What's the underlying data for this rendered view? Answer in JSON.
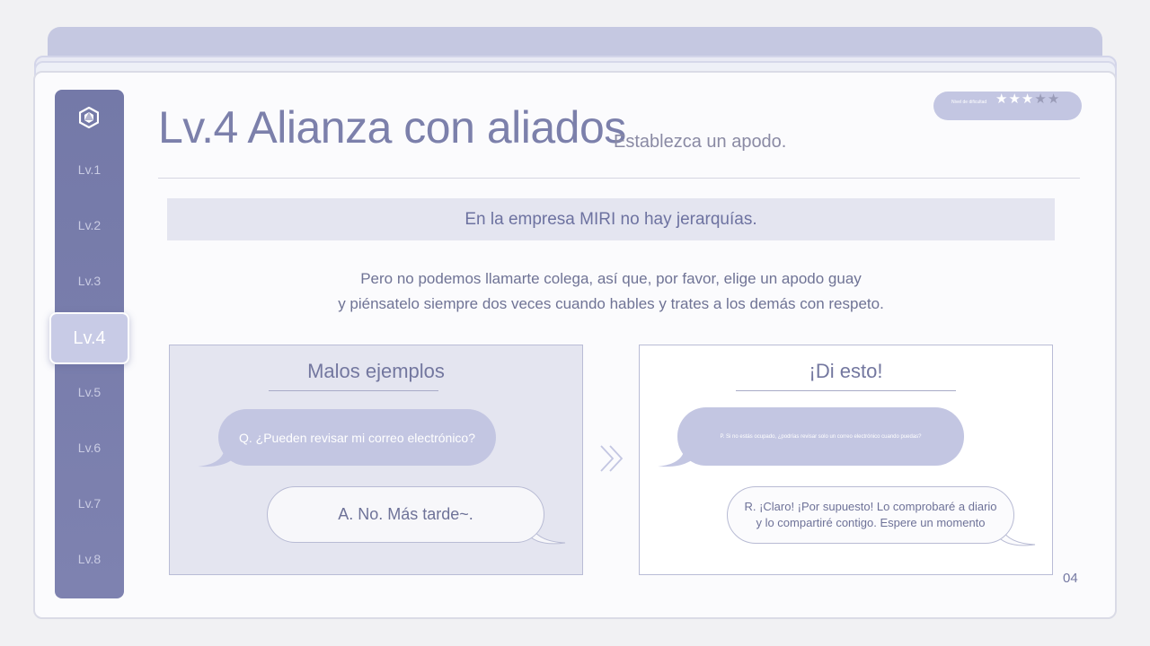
{
  "slide": {
    "title": "Lv.4 Alianza con aliados",
    "subtitle": "Establezca un apodo.",
    "difficulty": {
      "label": "Nivel de dificultad",
      "rating": 3,
      "max": 5
    },
    "page_number": "04"
  },
  "sidebar": {
    "logo": "hexagon-logo-icon",
    "items": [
      {
        "label": "Lv.1"
      },
      {
        "label": "Lv.2"
      },
      {
        "label": "Lv.3"
      },
      {
        "label": "Lv.4",
        "active": true
      },
      {
        "label": "Lv.5"
      },
      {
        "label": "Lv.6"
      },
      {
        "label": "Lv.7"
      },
      {
        "label": "Lv.8"
      }
    ]
  },
  "banner": "En la empresa MIRI no hay jerarquías.",
  "description": [
    "Pero no podemos llamarte colega, así que, por favor, elige un apodo guay",
    "y piénsatelo siempre dos veces cuando hables y trates a los demás con respeto."
  ],
  "bad_examples": {
    "title": "Malos ejemplos",
    "question": "Q. ¿Pueden revisar mi correo electrónico?",
    "answer": "A. No. Más tarde~."
  },
  "good_examples": {
    "title": "¡Di esto!",
    "question": "P. Si no estás ocupado, ¿podrías revisar solo un correo electrónico cuando puedas?",
    "answer_line1": "R. ¡Claro! ¡Por supuesto! Lo comprobaré a diario",
    "answer_line2": "y lo compartiré contigo. Espere un momento"
  },
  "colors": {
    "accent": "#7479a8",
    "bubble": "#c3c6e2",
    "panel_bg": "#e4e5f0",
    "text": "#6f7395"
  }
}
